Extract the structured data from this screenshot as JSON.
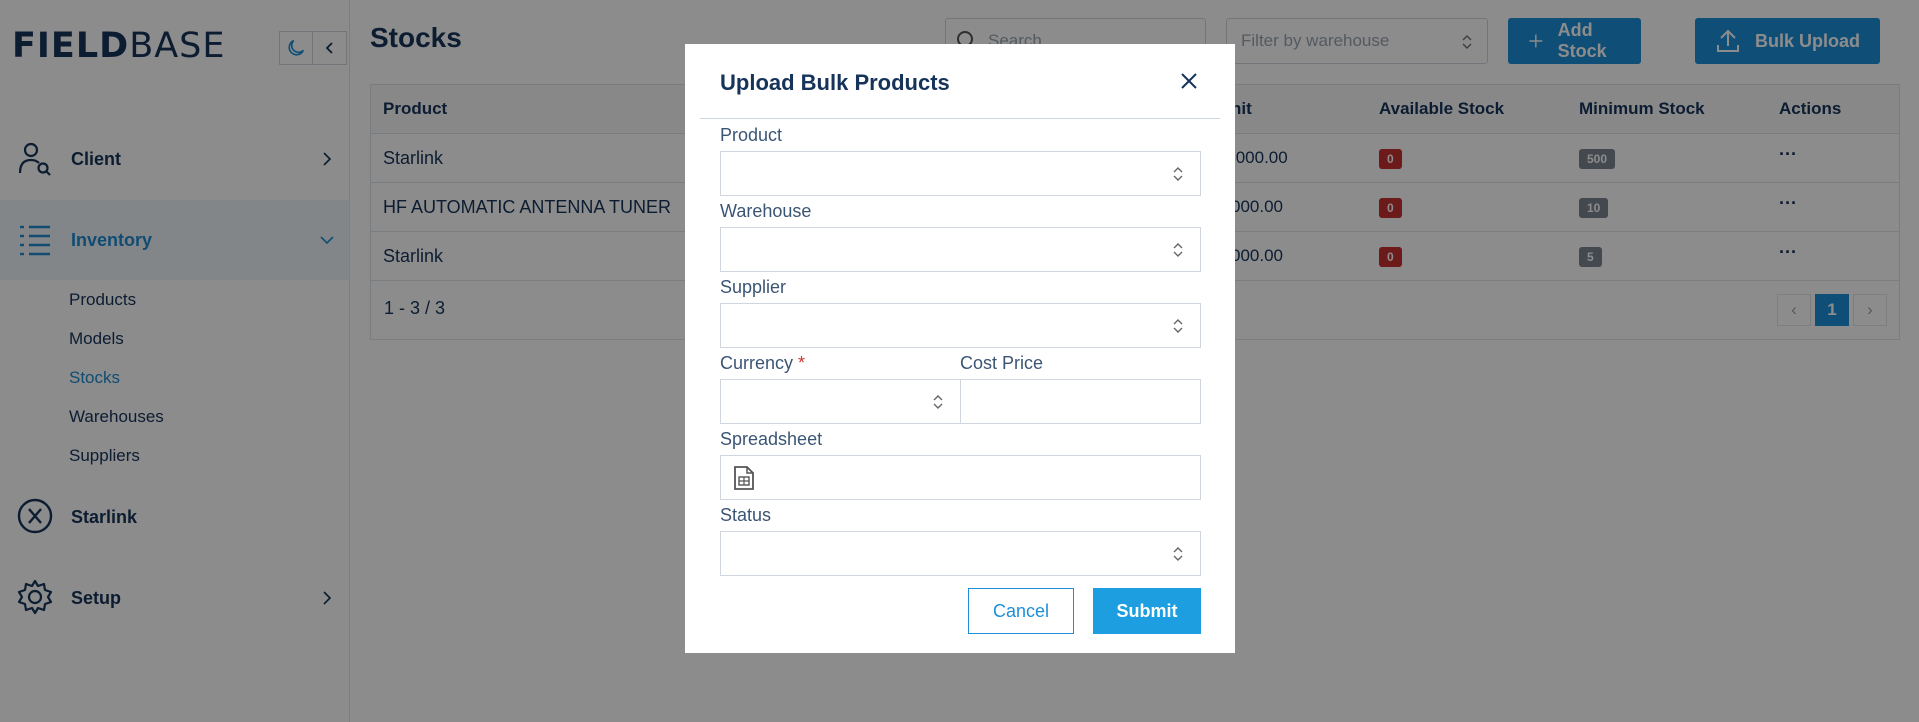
{
  "sidebar": {
    "logo": {
      "part1": "FIELD",
      "part2": "BASE"
    },
    "nav": [
      {
        "label": "Client",
        "icon": "user-search-icon"
      },
      {
        "label": "Inventory",
        "icon": "list-icon"
      },
      {
        "label": "Starlink",
        "icon": "x-circle-icon"
      },
      {
        "label": "Setup",
        "icon": "gear-icon"
      }
    ],
    "inventory_sub": [
      "Products",
      "Models",
      "Stocks",
      "Warehouses",
      "Suppliers"
    ]
  },
  "main": {
    "title": "Stocks",
    "search_placeholder": "Search",
    "filter_placeholder": "Filter by warehouse",
    "add_stock_label": "Add Stock",
    "bulk_upload_label": "Bulk Upload",
    "table": {
      "headers": [
        "Product",
        "nit",
        "Available Stock",
        "Minimum Stock",
        "Actions"
      ],
      "rows": [
        {
          "product": "Starlink",
          "unit": ",000.00",
          "available": "0",
          "minimum": "500",
          "actions": "···"
        },
        {
          "product": "HF AUTOMATIC ANTENNA TUNER",
          "unit": "000.00",
          "available": "0",
          "minimum": "10",
          "actions": "···"
        },
        {
          "product": "Starlink",
          "unit": "000.00",
          "available": "0",
          "minimum": "5",
          "actions": "···"
        }
      ],
      "count": "1 - 3 / 3",
      "current_page": "1",
      "prev": "‹",
      "next": "›"
    }
  },
  "modal": {
    "title": "Upload Bulk Products",
    "fields": {
      "product": "Product",
      "warehouse": "Warehouse",
      "supplier": "Supplier",
      "currency": "Currency",
      "currency_required": "*",
      "cost_price": "Cost Price",
      "spreadsheet": "Spreadsheet",
      "status": "Status"
    },
    "cancel_label": "Cancel",
    "submit_label": "Submit"
  },
  "colors": {
    "brand": "#16335a",
    "accent": "#1d8fd8",
    "danger": "#c53030"
  }
}
